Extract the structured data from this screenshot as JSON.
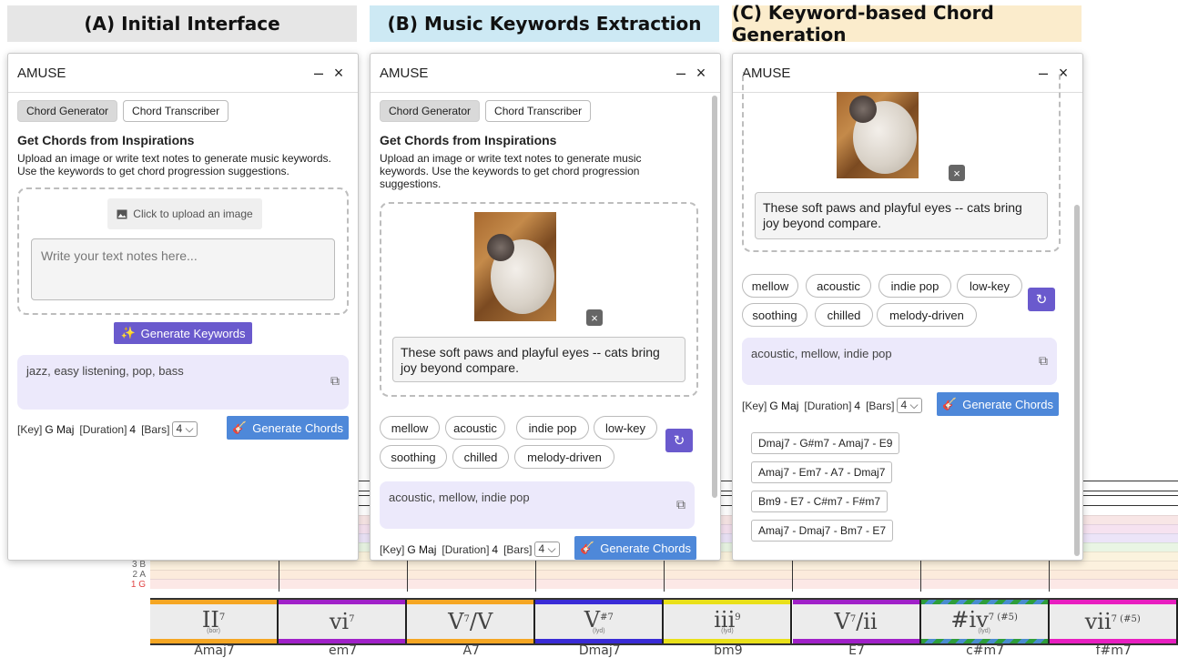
{
  "headers": {
    "a": {
      "label": "(A) Initial Interface",
      "bg": "#e6e6e6"
    },
    "b": {
      "label": "(B) Music Keywords Extraction",
      "bg": "#cde9f4"
    },
    "c": {
      "label": "(C) Keyword-based Chord Generation",
      "bg": "#fbeccc"
    }
  },
  "app": {
    "title": "AMUSE",
    "minimize": "–",
    "close": "×",
    "tab_generator": "Chord Generator",
    "tab_transcriber": "Chord Transcriber",
    "heading": "Get Chords from Inspirations",
    "description": "Upload an image or write text notes to generate music keywords. Use the keywords to get chord progression suggestions.",
    "upload_label": "Click to upload an image",
    "notes_placeholder": "Write your text notes here...",
    "generate_keywords": "Generate Keywords",
    "key_label": "[Key]",
    "key_value": "G Maj",
    "duration_label": "[Duration]",
    "duration_value": "4",
    "bars_label": "[Bars]",
    "bars_value": "4",
    "generate_chords": "Generate Chords",
    "remove": "×"
  },
  "window_a": {
    "keywords": "jazz, easy listening, pop, bass"
  },
  "window_b": {
    "notes": "These soft paws and playful eyes -- cats bring joy beyond compare.",
    "keywords": [
      "mellow",
      "acoustic",
      "indie pop",
      "low-key",
      "soothing",
      "chilled",
      "melody-driven"
    ],
    "selected": "acoustic, mellow, indie pop"
  },
  "window_c": {
    "notes": "These soft paws and playful eyes -- cats bring joy beyond compare.",
    "keywords": [
      "mellow",
      "acoustic",
      "indie pop",
      "low-key",
      "soothing",
      "chilled",
      "melody-driven"
    ],
    "selected": "acoustic, mellow, indie pop",
    "suggestions": [
      "Dmaj7 - G#m7 - Amaj7 - E9",
      "Amaj7 - Em7 - A7 - Dmaj7",
      "Bm9 - E7 - C#m7 - F#m7",
      "Amaj7 - Dmaj7 - Bm7 - E7"
    ]
  },
  "pianoroll": {
    "pitch_labels": [
      "3 B",
      "2 A",
      "1 G"
    ],
    "chords": [
      {
        "roman": "II",
        "sup": "7",
        "sub": "(bor)",
        "name": "Amaj7",
        "color": "#f5a623"
      },
      {
        "roman": "vi",
        "sup": "7",
        "sub": "",
        "name": "em7",
        "color": "#a020c8"
      },
      {
        "roman": "V",
        "sup": "7",
        "sub": "",
        "rest": "/V",
        "name": "A7",
        "color": "#f5a623"
      },
      {
        "roman": "V",
        "sup": "#7",
        "sub": "(lyd)",
        "name": "Dmaj7",
        "color": "#3a2bd6"
      },
      {
        "roman": "iii",
        "sup": "9",
        "sub": "(lyd)",
        "name": "bm9",
        "color": "#e9e01a"
      },
      {
        "roman": "V",
        "sup": "7",
        "sub": "",
        "rest": "/ii",
        "name": "E7",
        "color": "#a020c8"
      },
      {
        "roman": "#iv",
        "sup": "7 (#5)",
        "sub": "(lyd)",
        "name": "c#m7",
        "color": "#2e9e3a"
      },
      {
        "roman": "vii",
        "sup": "7 (#5)",
        "sub": "",
        "name": "f#m7",
        "color": "#e81ec0"
      }
    ]
  }
}
